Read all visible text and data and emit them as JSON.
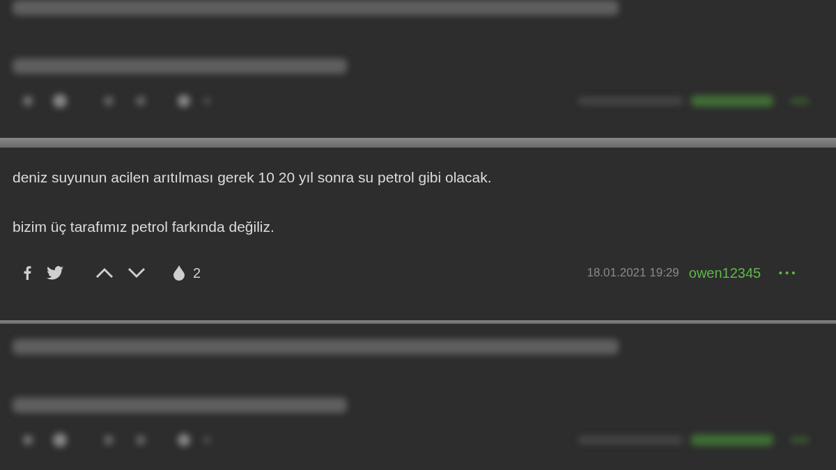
{
  "entries": [
    {
      "blurred": true
    },
    {
      "blurred": false,
      "paragraphs": [
        "deniz suyunun acilen arıtılması gerek 10 20 yıl sonra su petrol gibi olacak.",
        "bizim üç tarafımız petrol farkında değiliz."
      ],
      "favorites": "2",
      "date": "18.01.2021 19:29",
      "author": "owen12345",
      "more": "•••"
    },
    {
      "blurred": true
    }
  ]
}
